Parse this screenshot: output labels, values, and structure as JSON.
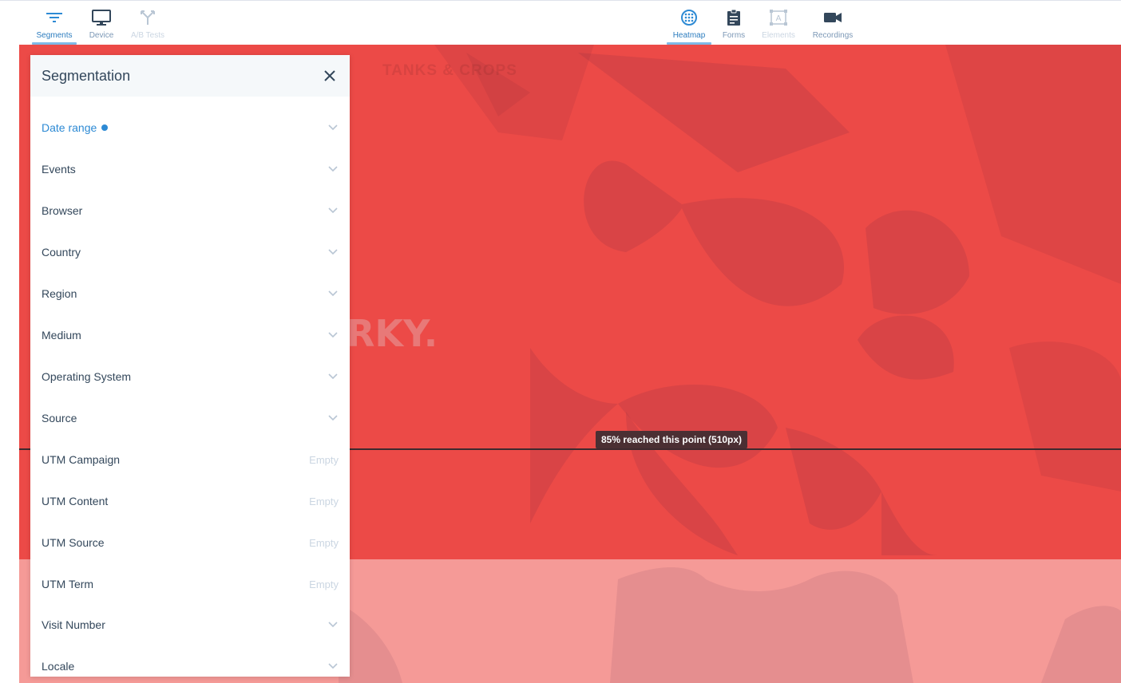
{
  "toolbar": {
    "left": [
      {
        "label": "Segments",
        "icon": "filter-icon",
        "state": "active"
      },
      {
        "label": "Device",
        "icon": "monitor-icon",
        "state": "normal"
      },
      {
        "label": "A/B Tests",
        "icon": "split-icon",
        "state": "disabled"
      }
    ],
    "right": [
      {
        "label": "Heatmap",
        "icon": "heatmap-icon",
        "state": "active"
      },
      {
        "label": "Forms",
        "icon": "clipboard-icon",
        "state": "normal"
      },
      {
        "label": "Elements",
        "icon": "element-select-icon",
        "state": "disabled"
      },
      {
        "label": "Recordings",
        "icon": "video-camera-icon",
        "state": "normal"
      }
    ]
  },
  "heatmap": {
    "scroll_marker": "85% reached this point (510px)",
    "page_nav_ghost": "TANKS & CROPS",
    "page_headline_ghost": "RKY.",
    "colors": {
      "hot": "#ec4a47",
      "warm": "#f59a97",
      "marker": "#4b2f33"
    }
  },
  "panel": {
    "title": "Segmentation",
    "close_icon": "close-icon",
    "filters": [
      {
        "label": "Date range",
        "trailing": "chevron",
        "active": true
      },
      {
        "label": "Events",
        "trailing": "chevron"
      },
      {
        "label": "Browser",
        "trailing": "chevron"
      },
      {
        "label": "Country",
        "trailing": "chevron"
      },
      {
        "label": "Region",
        "trailing": "chevron"
      },
      {
        "label": "Medium",
        "trailing": "chevron"
      },
      {
        "label": "Operating System",
        "trailing": "chevron"
      },
      {
        "label": "Source",
        "trailing": "chevron"
      },
      {
        "label": "UTM Campaign",
        "trailing": "text",
        "value": "Empty"
      },
      {
        "label": "UTM Content",
        "trailing": "text",
        "value": "Empty"
      },
      {
        "label": "UTM Source",
        "trailing": "text",
        "value": "Empty"
      },
      {
        "label": "UTM Term",
        "trailing": "text",
        "value": "Empty"
      },
      {
        "label": "Visit Number",
        "trailing": "chevron"
      },
      {
        "label": "Locale",
        "trailing": "chevron"
      }
    ],
    "accent": "#2d8ad4"
  }
}
